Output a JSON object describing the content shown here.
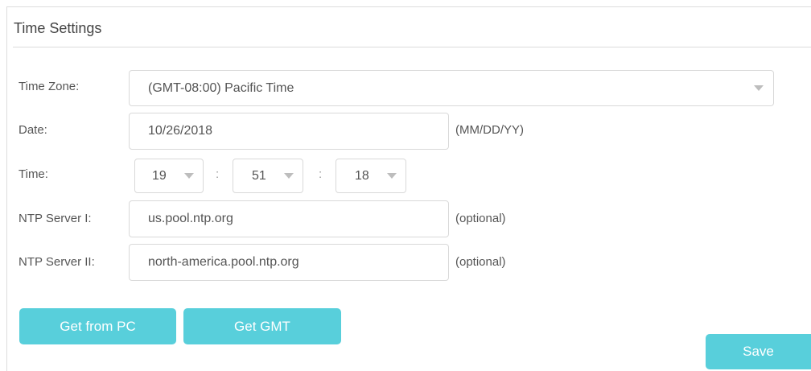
{
  "section": {
    "title": "Time Settings"
  },
  "time_zone": {
    "label": "Time Zone:",
    "value": "(GMT-08:00) Pacific Time"
  },
  "date": {
    "label": "Date:",
    "value": "10/26/2018",
    "format_hint": "(MM/DD/YY)"
  },
  "time": {
    "label": "Time:",
    "hour": "19",
    "minute": "51",
    "second": "18",
    "separator": ":"
  },
  "ntp1": {
    "label": "NTP Server I:",
    "value": "us.pool.ntp.org",
    "hint": "(optional)"
  },
  "ntp2": {
    "label": "NTP Server II:",
    "value": "north-america.pool.ntp.org",
    "hint": "(optional)"
  },
  "buttons": {
    "get_from_pc": "Get from PC",
    "get_gmt": "Get GMT",
    "save": "Save"
  },
  "colors": {
    "button": "#58cfdb",
    "border": "#d9d9d9",
    "text": "#555555"
  },
  "icons": {
    "dropdown": "chevron-down-icon"
  }
}
